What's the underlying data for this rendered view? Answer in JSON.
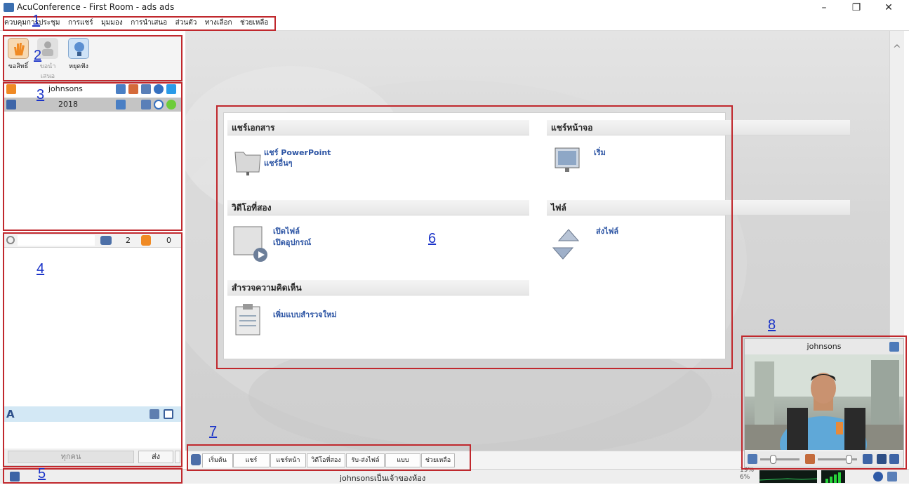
{
  "window": {
    "title": "AcuConference - First Room - ads ads",
    "controls": [
      "–",
      "❐",
      "✕"
    ]
  },
  "menu": [
    "ควบคุมการประชุม",
    "การแชร์",
    "มุมมอง",
    "การนำเสนอ",
    "ส่วนตัว",
    "ทางเลือก",
    "ช่วยเหลือ"
  ],
  "toolbar": {
    "raise_hand": "ขอสิทธิ์",
    "request_present": "ขอนำเสนอ",
    "stop_listen": "หยุดฟัง"
  },
  "participants": [
    {
      "name": "johnsons"
    },
    {
      "name": "2018"
    }
  ],
  "chat": {
    "user_count": "2",
    "hand_count": "0",
    "recipient": "ทุกคน",
    "send_label": "ส่ง"
  },
  "panel": {
    "share_docs": {
      "header": "แชร์เอกสาร",
      "link1": "แชร์ PowerPoint",
      "link2": "แชร์อื่นๆ"
    },
    "share_screen": {
      "header": "แชร์หน้าจอ",
      "link1": "เริ่ม"
    },
    "video2": {
      "header": "วิดีโอที่สอง",
      "link1": "เปิดไฟล์",
      "link2": "เปิดอุปกรณ์"
    },
    "files": {
      "header": "ไฟล์",
      "link1": "ส่งไฟล์"
    },
    "survey": {
      "header": "สำรวจความคิดเห็น",
      "link1": "เพิ่มแบบสำรวจใหม่"
    }
  },
  "tabs": [
    "เริ่มต้น",
    "แชร์เอกสาร",
    "แชร์หน้าจอ",
    "วิดีโอที่สอง",
    "รับ-ส่งไฟล์",
    "แบบสำรวจ",
    "ช่วยเหลือ"
  ],
  "status": {
    "host_text": "johnsonsเป็นเจ้าของห้อง",
    "cpu_top": "19%",
    "cpu_bottom": "6%"
  },
  "video": {
    "title": "johnsons"
  },
  "callouts": [
    "1",
    "2",
    "3",
    "4",
    "5",
    "6",
    "7",
    "8"
  ],
  "colors": {
    "callout_border": "#c0282d",
    "callout_number": "#1a33c8",
    "link": "#2d55a4"
  }
}
